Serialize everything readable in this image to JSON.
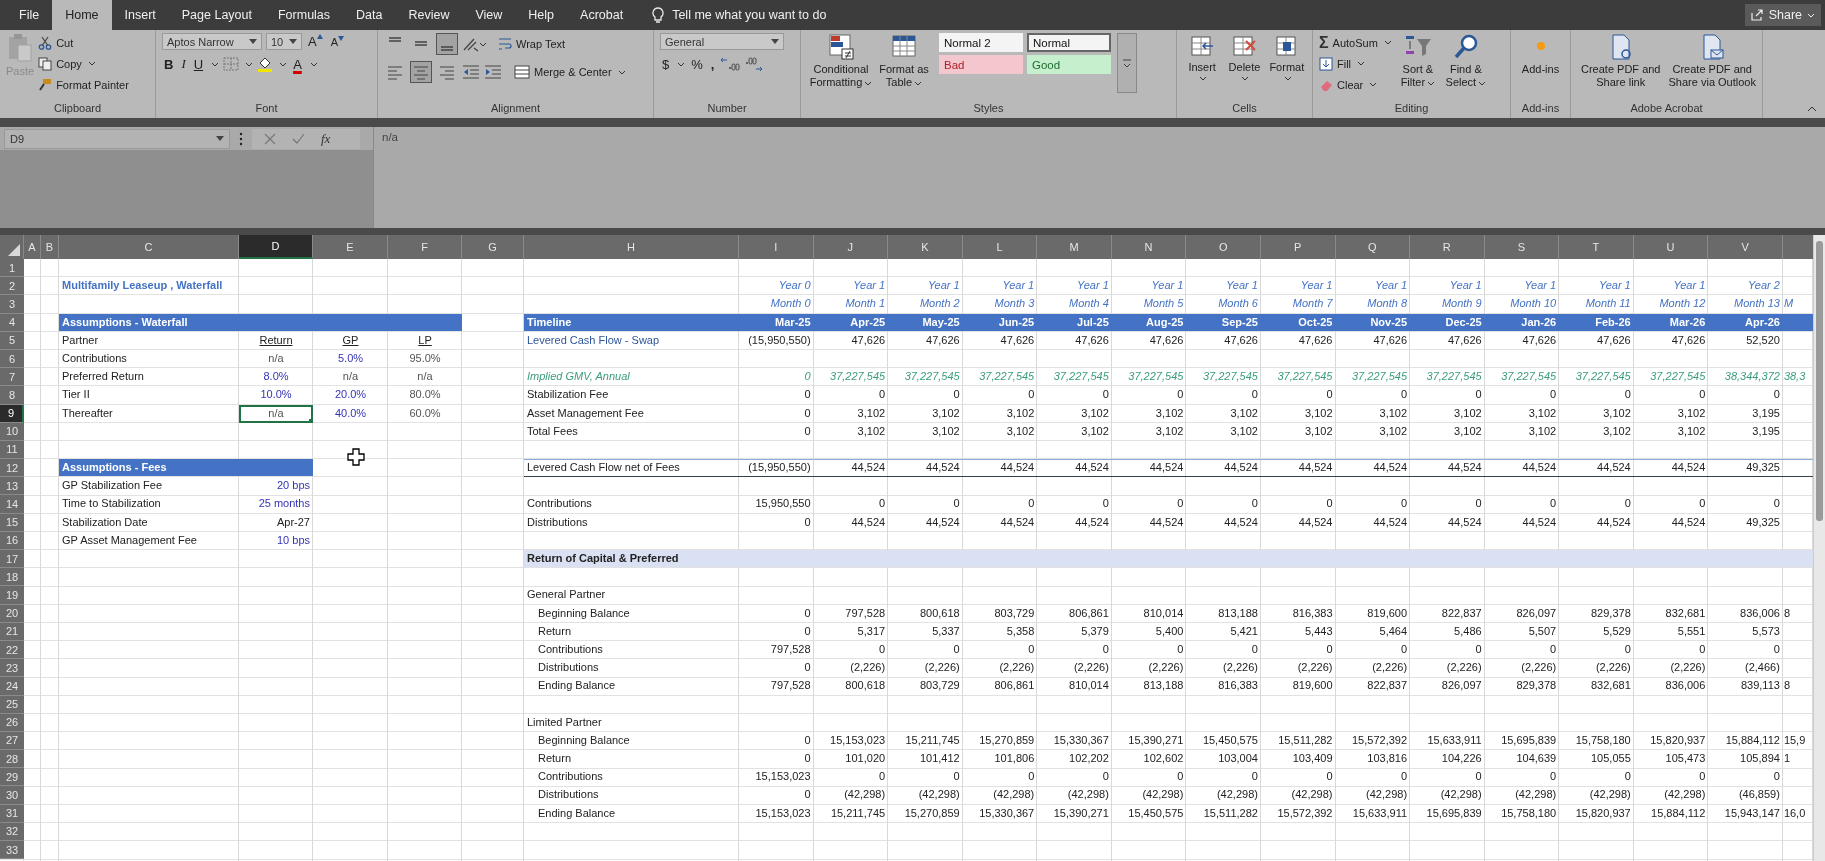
{
  "menu": {
    "tabs": [
      {
        "label": "File",
        "selected": false
      },
      {
        "label": "Home",
        "selected": true
      },
      {
        "label": "Insert",
        "selected": false
      },
      {
        "label": "Page Layout",
        "selected": false
      },
      {
        "label": "Formulas",
        "selected": false
      },
      {
        "label": "Data",
        "selected": false
      },
      {
        "label": "Review",
        "selected": false
      },
      {
        "label": "View",
        "selected": false
      },
      {
        "label": "Help",
        "selected": false
      },
      {
        "label": "Acrobat",
        "selected": false
      }
    ],
    "tell_me": "Tell me what you want to do",
    "share": "Share"
  },
  "ribbon": {
    "clipboard": {
      "label": "Clipboard",
      "paste": {
        "label": "Paste",
        "disabled": true
      },
      "cut": "Cut",
      "copy": "Copy",
      "format_painter": "Format Painter"
    },
    "font": {
      "label": "Font",
      "family": "Aptos Narrow",
      "size": "10",
      "grow": "A",
      "shrink": "A",
      "bold": "B",
      "italic": "I",
      "underline": "U",
      "font_color": "A"
    },
    "alignment": {
      "label": "Alignment",
      "vertical": [
        {
          "selected": false
        },
        {
          "selected": false
        },
        {
          "selected": true
        }
      ],
      "horizontal": [
        {
          "selected": false
        },
        {
          "selected": true
        },
        {
          "selected": false
        }
      ],
      "wrap": "Wrap Text",
      "merge": "Merge & Center"
    },
    "number": {
      "label": "Number",
      "format": "General",
      "currency": "$",
      "percent": "%",
      "comma": ","
    },
    "styles": {
      "label": "Styles",
      "buttons": [
        "Conditional Formatting",
        "Format as Table"
      ],
      "items": [
        {
          "text": "Normal 2",
          "kind": "normal",
          "selected": false
        },
        {
          "text": "Normal",
          "kind": "normal",
          "selected": true
        },
        {
          "text": "Bad",
          "kind": "bad",
          "selected": false
        },
        {
          "text": "Good",
          "kind": "good",
          "selected": false
        }
      ]
    },
    "cells": {
      "label": "Cells",
      "buttons": [
        "Insert",
        "Delete",
        "Format"
      ]
    },
    "editing": {
      "label": "Editing",
      "sigma": "Σ",
      "autosum": "AutoSum",
      "fill": "Fill",
      "clear": "Clear",
      "sort": "Sort & Filter",
      "find": "Find & Select"
    },
    "addins": {
      "label": "Add-ins",
      "button": "Add-ins"
    },
    "acrobat": {
      "label": "Adobe Acrobat",
      "buttons": [
        "Create PDF and Share link",
        "Create PDF and Share via Outlook"
      ]
    }
  },
  "formula_bar": {
    "name_box": "D9",
    "fx": "fx",
    "value": "n/a"
  },
  "sheet": {
    "columns": [
      {
        "label": "A",
        "selected": false
      },
      {
        "label": "B",
        "selected": false
      },
      {
        "label": "C",
        "selected": false
      },
      {
        "label": "D",
        "selected": true
      },
      {
        "label": "E",
        "selected": false
      },
      {
        "label": "F",
        "selected": false
      },
      {
        "label": "G",
        "selected": false
      },
      {
        "label": "H",
        "selected": false
      },
      {
        "label": "I",
        "selected": false
      },
      {
        "label": "J",
        "selected": false
      },
      {
        "label": "K",
        "selected": false
      },
      {
        "label": "L",
        "selected": false
      },
      {
        "label": "M",
        "selected": false
      },
      {
        "label": "N",
        "selected": false
      },
      {
        "label": "O",
        "selected": false
      },
      {
        "label": "P",
        "selected": false
      },
      {
        "label": "Q",
        "selected": false
      },
      {
        "label": "R",
        "selected": false
      },
      {
        "label": "S",
        "selected": false
      },
      {
        "label": "T",
        "selected": false
      },
      {
        "label": "U",
        "selected": false
      },
      {
        "label": "V",
        "selected": false
      }
    ],
    "rows": [
      {
        "number": "1",
        "selected": false
      },
      {
        "number": "2",
        "selected": false,
        "left": [
          {
            "text": "Multifamily Leaseup , Waterfall",
            "kind": "title",
            "selected": false
          }
        ],
        "right": {
          "kind": "period",
          "values": [
            "Year 0",
            "Year 1",
            "Year 1",
            "Year 1",
            "Year 1",
            "Year 1",
            "Year 1",
            "Year 1",
            "Year 1",
            "Year 1",
            "Year 1",
            "Year 1",
            "Year 1",
            "Year 2"
          ]
        }
      },
      {
        "number": "3",
        "selected": false,
        "right": {
          "kind": "period",
          "values": [
            "Month 0",
            "Month 1",
            "Month 2",
            "Month 3",
            "Month 4",
            "Month 5",
            "Month 6",
            "Month 7",
            "Month 8",
            "Month 9",
            "Month 10",
            "Month 11",
            "Month 12",
            "Month 13",
            "M"
          ]
        }
      },
      {
        "number": "4",
        "selected": false,
        "left": [
          {
            "text": "Assumptions - Waterfall",
            "kind": "band",
            "banded": true,
            "selected": false
          },
          {
            "banded": true
          },
          {
            "banded": true
          },
          {
            "banded": true
          }
        ],
        "right": {
          "band": {
            "kind": "header"
          },
          "label": {
            "text": "Timeline",
            "kind": "band"
          },
          "kind": "date",
          "values": [
            "Mar-25",
            "Apr-25",
            "May-25",
            "Jun-25",
            "Jul-25",
            "Aug-25",
            "Sep-25",
            "Oct-25",
            "Nov-25",
            "Dec-25",
            "Jan-26",
            "Feb-26",
            "Mar-26",
            "Apr-26"
          ]
        }
      },
      {
        "number": "5",
        "selected": false,
        "left": [
          {
            "text": "Partner",
            "kind": "label",
            "selected": false
          },
          {
            "text": "Return",
            "kind": "head",
            "selected": false
          },
          {
            "text": "GP",
            "kind": "head",
            "selected": false
          },
          {
            "text": "LP",
            "kind": "head",
            "selected": false
          }
        ],
        "right": {
          "label": {
            "text": "Levered Cash Flow - Swap",
            "kind": "link"
          },
          "kind": "number",
          "values": [
            "(15,950,550)",
            "47,626",
            "47,626",
            "47,626",
            "47,626",
            "47,626",
            "47,626",
            "47,626",
            "47,626",
            "47,626",
            "47,626",
            "47,626",
            "47,626",
            "52,520"
          ]
        }
      },
      {
        "number": "6",
        "selected": false,
        "left": [
          {
            "text": "Contributions",
            "kind": "label",
            "selected": false
          },
          {
            "text": "n/a",
            "kind": "center",
            "selected": false
          },
          {
            "text": "5.0%",
            "kind": "input_center",
            "selected": false
          },
          {
            "text": "95.0%",
            "kind": "center",
            "selected": false
          }
        ]
      },
      {
        "number": "7",
        "selected": false,
        "left": [
          {
            "text": "Preferred Return",
            "kind": "label",
            "selected": false
          },
          {
            "text": "8.0%",
            "kind": "input_center",
            "selected": false
          },
          {
            "text": "n/a",
            "kind": "center",
            "selected": false
          },
          {
            "text": "n/a",
            "kind": "center",
            "selected": false
          }
        ],
        "right": {
          "label": {
            "text": "Implied GMV, Annual",
            "kind": "implied"
          },
          "kind": "implied",
          "values": [
            "0",
            "37,227,545",
            "37,227,545",
            "37,227,545",
            "37,227,545",
            "37,227,545",
            "37,227,545",
            "37,227,545",
            "37,227,545",
            "37,227,545",
            "37,227,545",
            "37,227,545",
            "37,227,545",
            "38,344,372",
            "38,3"
          ]
        }
      },
      {
        "number": "8",
        "selected": false,
        "left": [
          {
            "text": "Tier II",
            "kind": "label",
            "selected": false
          },
          {
            "text": "10.0%",
            "kind": "input_center",
            "selected": false
          },
          {
            "text": "20.0%",
            "kind": "input_center",
            "selected": false
          },
          {
            "text": "80.0%",
            "kind": "center",
            "selected": false
          }
        ],
        "right": {
          "label": {
            "text": "Stabilization Fee",
            "kind": "label"
          },
          "kind": "number",
          "values": [
            "0",
            "0",
            "0",
            "0",
            "0",
            "0",
            "0",
            "0",
            "0",
            "0",
            "0",
            "0",
            "0",
            "0"
          ]
        }
      },
      {
        "number": "9",
        "selected": true,
        "left": [
          {
            "text": "Thereafter",
            "kind": "label",
            "selected": false
          },
          {
            "text": "n/a",
            "kind": "center",
            "selected": true
          },
          {
            "text": "40.0%",
            "kind": "input_center",
            "selected": false
          },
          {
            "text": "60.0%",
            "kind": "center",
            "selected": false
          }
        ],
        "right": {
          "label": {
            "text": "Asset Management Fee",
            "kind": "label"
          },
          "kind": "number",
          "values": [
            "0",
            "3,102",
            "3,102",
            "3,102",
            "3,102",
            "3,102",
            "3,102",
            "3,102",
            "3,102",
            "3,102",
            "3,102",
            "3,102",
            "3,102",
            "3,195"
          ]
        }
      },
      {
        "number": "10",
        "selected": false,
        "right": {
          "label": {
            "text": "Total Fees",
            "kind": "label"
          },
          "kind": "number",
          "values": [
            "0",
            "3,102",
            "3,102",
            "3,102",
            "3,102",
            "3,102",
            "3,102",
            "3,102",
            "3,102",
            "3,102",
            "3,102",
            "3,102",
            "3,102",
            "3,195"
          ]
        }
      },
      {
        "number": "11",
        "selected": false
      },
      {
        "number": "12",
        "selected": false,
        "left": [
          {
            "text": "Assumptions - Fees",
            "kind": "band",
            "banded": true,
            "selected": false
          },
          {
            "banded": true
          }
        ],
        "right": {
          "ruled": true,
          "label": {
            "text": "Levered Cash Flow net of Fees",
            "kind": "label"
          },
          "kind": "number",
          "values": [
            "(15,950,550)",
            "44,524",
            "44,524",
            "44,524",
            "44,524",
            "44,524",
            "44,524",
            "44,524",
            "44,524",
            "44,524",
            "44,524",
            "44,524",
            "44,524",
            "49,325"
          ]
        }
      },
      {
        "number": "13",
        "selected": false,
        "left": [
          {
            "text": "GP Stabilization Fee",
            "kind": "label",
            "selected": false
          },
          {
            "text": "20 bps",
            "kind": "input",
            "selected": false
          }
        ]
      },
      {
        "number": "14",
        "selected": false,
        "left": [
          {
            "text": "Time to Stabilization",
            "kind": "label",
            "selected": false
          },
          {
            "text": "25 months",
            "kind": "input",
            "selected": false
          }
        ],
        "right": {
          "label": {
            "text": "Contributions",
            "kind": "label"
          },
          "kind": "number",
          "values": [
            "15,950,550",
            "0",
            "0",
            "0",
            "0",
            "0",
            "0",
            "0",
            "0",
            "0",
            "0",
            "0",
            "0",
            "0"
          ]
        }
      },
      {
        "number": "15",
        "selected": false,
        "left": [
          {
            "text": "Stabilization Date",
            "kind": "label",
            "selected": false
          },
          {
            "text": "Apr-27",
            "kind": "value",
            "selected": false
          }
        ],
        "right": {
          "label": {
            "text": "Distributions",
            "kind": "label"
          },
          "kind": "number",
          "values": [
            "0",
            "44,524",
            "44,524",
            "44,524",
            "44,524",
            "44,524",
            "44,524",
            "44,524",
            "44,524",
            "44,524",
            "44,524",
            "44,524",
            "44,524",
            "49,325"
          ]
        }
      },
      {
        "number": "16",
        "selected": false,
        "left": [
          {
            "text": "GP Asset Management Fee",
            "kind": "label",
            "selected": false
          },
          {
            "text": "10 bps",
            "kind": "input",
            "selected": false
          }
        ]
      },
      {
        "number": "17",
        "selected": false,
        "right": {
          "band": {
            "kind": "section"
          },
          "label": {
            "text": "Return of Capital & Preferred",
            "kind": "bold"
          }
        }
      },
      {
        "number": "18",
        "selected": false
      },
      {
        "number": "19",
        "selected": false,
        "right": {
          "label": {
            "text": "General Partner",
            "kind": "label"
          }
        }
      },
      {
        "number": "20",
        "selected": false,
        "right": {
          "label": {
            "text": "Beginning Balance",
            "kind": "indent"
          },
          "kind": "number",
          "values": [
            "0",
            "797,528",
            "800,618",
            "803,729",
            "806,861",
            "810,014",
            "813,188",
            "816,383",
            "819,600",
            "822,837",
            "826,097",
            "829,378",
            "832,681",
            "836,006",
            "8"
          ]
        }
      },
      {
        "number": "21",
        "selected": false,
        "right": {
          "label": {
            "text": "Return",
            "kind": "indent"
          },
          "kind": "number",
          "values": [
            "0",
            "5,317",
            "5,337",
            "5,358",
            "5,379",
            "5,400",
            "5,421",
            "5,443",
            "5,464",
            "5,486",
            "5,507",
            "5,529",
            "5,551",
            "5,573"
          ]
        }
      },
      {
        "number": "22",
        "selected": false,
        "right": {
          "label": {
            "text": "Contributions",
            "kind": "indent"
          },
          "kind": "number",
          "values": [
            "797,528",
            "0",
            "0",
            "0",
            "0",
            "0",
            "0",
            "0",
            "0",
            "0",
            "0",
            "0",
            "0",
            "0"
          ]
        }
      },
      {
        "number": "23",
        "selected": false,
        "right": {
          "label": {
            "text": "Distributions",
            "kind": "indent"
          },
          "kind": "number",
          "values": [
            "0",
            "(2,226)",
            "(2,226)",
            "(2,226)",
            "(2,226)",
            "(2,226)",
            "(2,226)",
            "(2,226)",
            "(2,226)",
            "(2,226)",
            "(2,226)",
            "(2,226)",
            "(2,226)",
            "(2,466)"
          ]
        }
      },
      {
        "number": "24",
        "selected": false,
        "right": {
          "label": {
            "text": "Ending Balance",
            "kind": "indent"
          },
          "kind": "number",
          "values": [
            "797,528",
            "800,618",
            "803,729",
            "806,861",
            "810,014",
            "813,188",
            "816,383",
            "819,600",
            "822,837",
            "826,097",
            "829,378",
            "832,681",
            "836,006",
            "839,113",
            "8"
          ]
        }
      },
      {
        "number": "25",
        "selected": false
      },
      {
        "number": "26",
        "selected": false,
        "right": {
          "label": {
            "text": "Limited Partner",
            "kind": "label"
          }
        }
      },
      {
        "number": "27",
        "selected": false,
        "right": {
          "label": {
            "text": "Beginning Balance",
            "kind": "indent"
          },
          "kind": "number",
          "values": [
            "0",
            "15,153,023",
            "15,211,745",
            "15,270,859",
            "15,330,367",
            "15,390,271",
            "15,450,575",
            "15,511,282",
            "15,572,392",
            "15,633,911",
            "15,695,839",
            "15,758,180",
            "15,820,937",
            "15,884,112",
            "15,9"
          ]
        }
      },
      {
        "number": "28",
        "selected": false,
        "right": {
          "label": {
            "text": "Return",
            "kind": "indent"
          },
          "kind": "number",
          "values": [
            "0",
            "101,020",
            "101,412",
            "101,806",
            "102,202",
            "102,602",
            "103,004",
            "103,409",
            "103,816",
            "104,226",
            "104,639",
            "105,055",
            "105,473",
            "105,894",
            "1"
          ]
        }
      },
      {
        "number": "29",
        "selected": false,
        "right": {
          "label": {
            "text": "Contributions",
            "kind": "indent"
          },
          "kind": "number",
          "values": [
            "15,153,023",
            "0",
            "0",
            "0",
            "0",
            "0",
            "0",
            "0",
            "0",
            "0",
            "0",
            "0",
            "0",
            "0"
          ]
        }
      },
      {
        "number": "30",
        "selected": false,
        "right": {
          "label": {
            "text": "Distributions",
            "kind": "indent"
          },
          "kind": "number",
          "values": [
            "0",
            "(42,298)",
            "(42,298)",
            "(42,298)",
            "(42,298)",
            "(42,298)",
            "(42,298)",
            "(42,298)",
            "(42,298)",
            "(42,298)",
            "(42,298)",
            "(42,298)",
            "(42,298)",
            "(46,859)"
          ]
        }
      },
      {
        "number": "31",
        "selected": false,
        "right": {
          "label": {
            "text": "Ending Balance",
            "kind": "indent"
          },
          "kind": "number",
          "values": [
            "15,153,023",
            "15,211,745",
            "15,270,859",
            "15,330,367",
            "15,390,271",
            "15,450,575",
            "15,511,282",
            "15,572,392",
            "15,633,911",
            "15,695,839",
            "15,758,180",
            "15,820,937",
            "15,884,112",
            "15,943,147",
            "16,0"
          ]
        }
      },
      {
        "number": "32",
        "selected": false
      },
      {
        "number": "33",
        "selected": false
      }
    ]
  }
}
